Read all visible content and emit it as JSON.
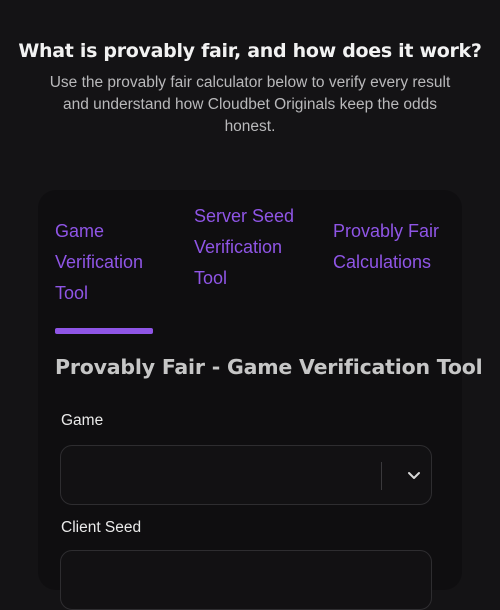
{
  "header": {
    "title": "What is provably fair, and how does it work?",
    "description": "Use the provably fair calculator below to verify every result and understand how Cloudbet Originals keep the odds honest."
  },
  "tabs": [
    {
      "label": "Game Verification Tool",
      "active": true
    },
    {
      "label": "Server Seed Verification Tool",
      "active": false
    },
    {
      "label": "Provably Fair Calculations",
      "active": false
    }
  ],
  "form": {
    "section_title": "Provably Fair - Game Verification Tool",
    "game_label": "Game",
    "game_value": "",
    "client_seed_label": "Client Seed",
    "client_seed_value": ""
  },
  "colors": {
    "accent": "#8f55e6",
    "background": "#141315",
    "card": "#0f0e10"
  },
  "icons": {
    "select_chevron": "chevron-down-icon"
  }
}
